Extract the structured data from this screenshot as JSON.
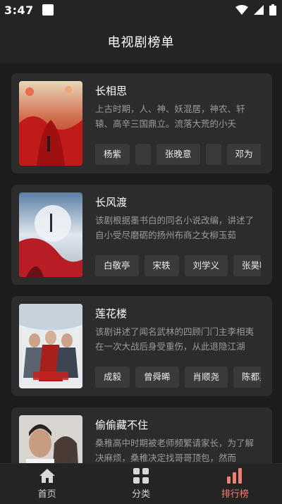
{
  "status_bar": {
    "time": "3:47"
  },
  "header": {
    "title": "电视剧榜单"
  },
  "dramas": [
    {
      "title": "长相思",
      "description": "上古时期，人、神、妖混居，神农、轩辕、高辛三国鼎立。流落大荒的小夭",
      "tags": [
        "杨紫",
        "",
        "张晚意",
        "",
        "邓为"
      ]
    },
    {
      "title": "长风渡",
      "description": "该剧根据墨书白的同名小说改编，讲述了自小受尽磨砺的扬州布商之女柳玉茹",
      "tags": [
        "白敬亭",
        "宋轶",
        "刘学义",
        "张昊唯"
      ]
    },
    {
      "title": "莲花楼",
      "description": "该剧讲述了闻名武林的四顾门门主李相夷在一次大战后身受重伤，从此退隐江湖",
      "tags": [
        "成毅",
        "曾舜晞",
        "肖顺尧",
        "陈都灵"
      ]
    },
    {
      "title": "偷偷藏不住",
      "description": "桑稚高中时期被老师频繁请家长，为了解决麻烦，桑稚决定找哥哥顶包，然而",
      "tags": []
    }
  ],
  "bottom_nav": [
    {
      "label": "首页",
      "icon": "home-icon",
      "active": false
    },
    {
      "label": "分类",
      "icon": "grid-icon",
      "active": false
    },
    {
      "label": "排行榜",
      "icon": "ranking-icon",
      "active": true
    }
  ],
  "colors": {
    "background": "#1c1c1c",
    "card": "#2c2c2c",
    "tag": "#3a3a3a",
    "accent": "#f08070"
  }
}
